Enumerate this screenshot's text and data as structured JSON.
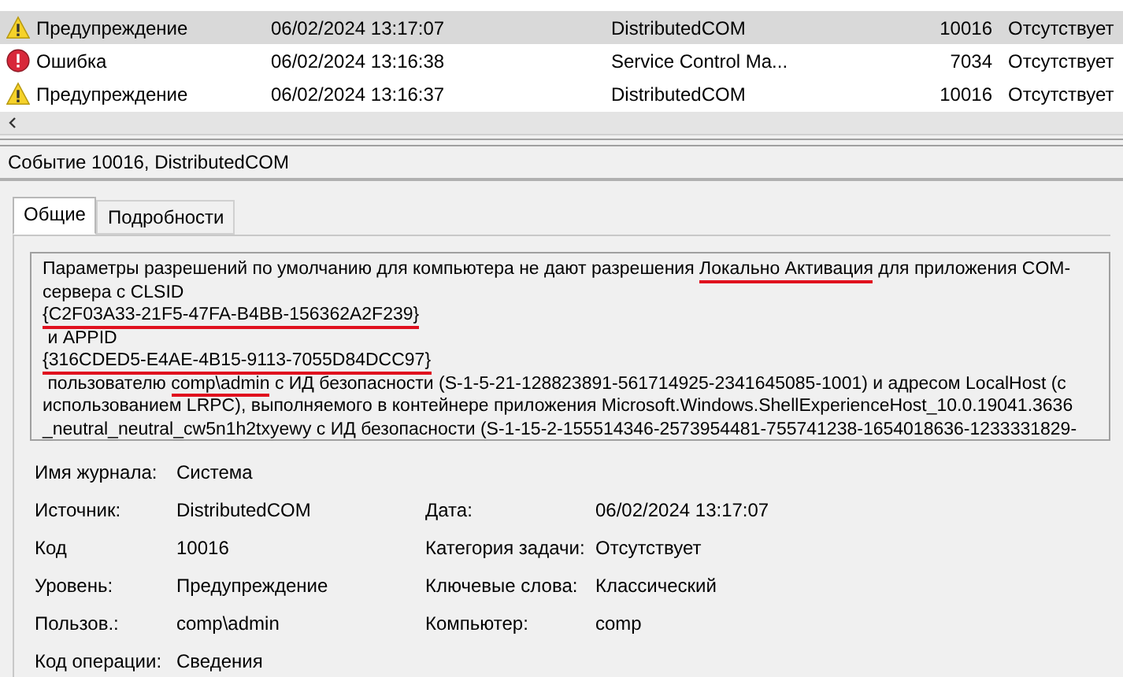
{
  "events": [
    {
      "kind": "warning",
      "level": "Предупреждение",
      "date": "06/02/2024 13:17:07",
      "source": "DistributedCOM",
      "code": "10016",
      "category": "Отсутствует",
      "selected": true
    },
    {
      "kind": "error",
      "level": "Ошибка",
      "date": "06/02/2024 13:16:38",
      "source": "Service Control Ma...",
      "code": "7034",
      "category": "Отсутствует",
      "selected": false
    },
    {
      "kind": "warning",
      "level": "Предупреждение",
      "date": "06/02/2024 13:16:37",
      "source": "DistributedCOM",
      "code": "10016",
      "category": "Отсутствует",
      "selected": false
    }
  ],
  "event_title": "Событие 10016, DistributedCOM",
  "tabs": [
    {
      "label": "Общие",
      "selected": true
    },
    {
      "label": "Подробности",
      "selected": false
    }
  ],
  "message_lines": [
    [
      {
        "text": "Параметры разрешений по умолчанию для компьютера не дают разрешения ",
        "underlined": false
      },
      {
        "text": "Локально Активация",
        "underlined": true
      },
      {
        "text": " для приложения COM-",
        "underlined": false
      }
    ],
    [
      {
        "text": "сервера с CLSID",
        "underlined": false
      }
    ],
    [
      {
        "text": "{C2F03A33-21F5-47FA-B4BB-156362A2F239}",
        "underlined": true
      }
    ],
    [
      {
        "text": " и APPID",
        "underlined": false
      }
    ],
    [
      {
        "text": "{316CDED5-E4AE-4B15-9113-7055D84DCC97}",
        "underlined": true
      }
    ],
    [
      {
        "text": " пользователю ",
        "underlined": false
      },
      {
        "text": "comp\\admin",
        "underlined": true
      },
      {
        "text": " с ИД безопасности (S-1-5-21-128823891-561714925-2341645085-1001) и адресом LocalHost (с",
        "underlined": false
      }
    ],
    [
      {
        "text": "использованием LRPC), выполняемого в контейнере приложения Microsoft.Windows.ShellExperienceHost_10.0.19041.3636",
        "underlined": false
      }
    ],
    [
      {
        "text": "_neutral_neutral_cw5n1h2txyewy с ИД безопасности (S-1-15-2-155514346-2573954481-755741238-1654018636-1233331829-",
        "underlined": false
      }
    ]
  ],
  "details": [
    [
      {
        "label": "Имя журнала:",
        "value": "Система"
      }
    ],
    [
      {
        "label": "Источник:",
        "value": "DistributedCOM"
      },
      {
        "label": "Дата:",
        "value": "06/02/2024 13:17:07"
      }
    ],
    [
      {
        "label": "Код",
        "value": "10016"
      },
      {
        "label": "Категория задачи:",
        "value": "Отсутствует"
      }
    ],
    [
      {
        "label": "Уровень:",
        "value": "Предупреждение"
      },
      {
        "label": "Ключевые слова:",
        "value": "Классический"
      }
    ],
    [
      {
        "label": "Пользов.:",
        "value": "comp\\admin"
      },
      {
        "label": "Компьютер:",
        "value": "comp"
      }
    ],
    [
      {
        "label": "Код операции:",
        "value": "Сведения"
      }
    ]
  ]
}
